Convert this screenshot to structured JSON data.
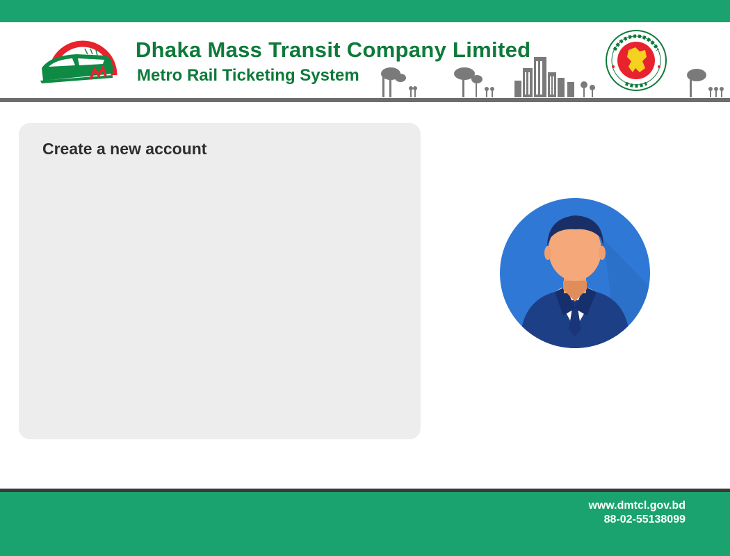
{
  "header": {
    "title": "Dhaka Mass Transit Company Limited",
    "subtitle": "Metro Rail Ticketing System",
    "logo_icon": "metro-rail-logo-icon",
    "seal_icon": "government-seal-icon"
  },
  "main": {
    "card_title": "Create a new account",
    "avatar_icon": "user-avatar-icon"
  },
  "footer": {
    "website": "www.dmtcl.gov.bd",
    "phone": "88-02-55138099"
  },
  "colors": {
    "brand_green": "#1aa36f",
    "title_green": "#0e7a3a",
    "logo_red": "#e8232d",
    "card_bg": "#ededed",
    "divider_gray": "#6d6d6d"
  }
}
